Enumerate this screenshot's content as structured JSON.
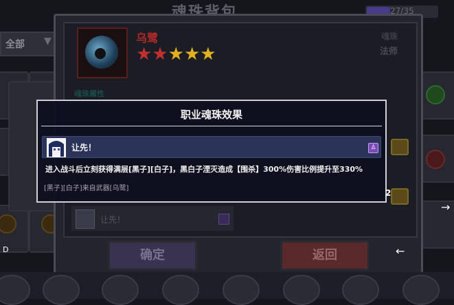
{
  "background": {
    "title": "魂珠背包",
    "bag_count": "27/35",
    "filter": {
      "label": "全部"
    },
    "colors": {
      "capacity_fill": "#4a3a8a"
    }
  },
  "detail": {
    "soul_name": "乌鹭",
    "rating": {
      "value": 5,
      "max": 5
    },
    "type_label": "魂珠",
    "class_label": "法师",
    "attributes_title": "魂珠属性",
    "skill_row_label": "让先！",
    "confirm_label": "确定",
    "back_label": "返回"
  },
  "modal": {
    "title": "职业魂珠效果",
    "skill": {
      "name": "让先！",
      "badge_icon": "class-badge-icon"
    },
    "description": "进入战斗后立刻获得满层[黑子][白子]，黑白子湮灭造成【围杀】300%伤害比例提升至330%",
    "source": "[黑子][白子]来自武器[乌鹭]"
  },
  "overlay": {
    "number_label": "2",
    "d_label": "D",
    "right_arrow": "→",
    "left_arrow": "←"
  },
  "colors": {
    "star_red": "#c03030",
    "star_gold": "#e0b020",
    "name_red": "#b02a2a",
    "modal_bg": "#0e0f20",
    "skill_row": "#2b3358"
  }
}
